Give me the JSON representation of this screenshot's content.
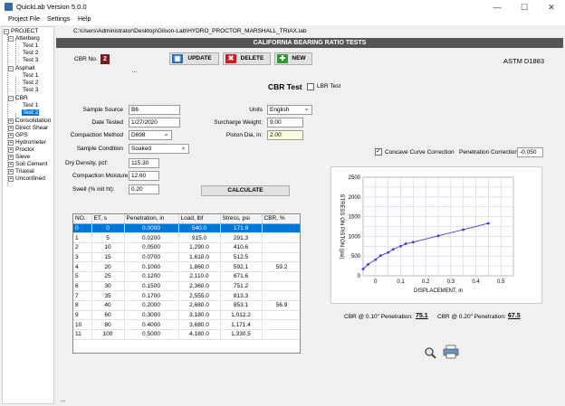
{
  "window": {
    "title": "QuickLab  Version 5.0.0",
    "minimize": "—",
    "maximize": "☐",
    "close": "✕"
  },
  "menu": [
    "Project File",
    "Settings",
    "Help"
  ],
  "tree": {
    "root": "PROJECT",
    "groups": [
      {
        "name": "Atterberg",
        "expanded": true,
        "children": [
          "Test 1",
          "Test 2",
          "Test 3"
        ]
      },
      {
        "name": "Asphalt",
        "expanded": true,
        "children": [
          "Test 1",
          "Test 2",
          "Test 3"
        ]
      },
      {
        "name": "CBR",
        "expanded": true,
        "children": [
          "Test 1",
          "Test 2"
        ]
      },
      {
        "name": "Consolidation"
      },
      {
        "name": "Direct Shear"
      },
      {
        "name": "GPS"
      },
      {
        "name": "Hydrometer"
      },
      {
        "name": "Proctor"
      },
      {
        "name": "Sieve"
      },
      {
        "name": "Soil Cement"
      },
      {
        "name": "Triaxial"
      },
      {
        "name": "Unconfined"
      }
    ],
    "selected": "Test 2"
  },
  "file_path": "C:\\Users\\Administrator\\Desktop\\Gilson-Lab\\HYDRO_PROCTOR_MARSHALL_TRIAX.lab",
  "header_title": "CALIFORNIA BEARING RATIO TESTS",
  "cbr_no": {
    "label": "CBR No.",
    "value": "2"
  },
  "toolbar": {
    "update": "UPDATE",
    "delete": "DELETE",
    "new": "NEW"
  },
  "standard": "ASTM D1883",
  "ellipsis": "...",
  "bottom_ellipsis": "...",
  "cbr_test_title": "CBR Test",
  "lbr_test_label": "LBR Test",
  "lbr_checked": false,
  "form": {
    "sample_source_label": "Sample Source",
    "sample_source": "B6",
    "date_tested_label": "Date Tested",
    "date_tested": "1/27/2020",
    "compaction_method_label": "Compaction Method",
    "compaction_method": "D698",
    "sample_condition_label": "Sample Condition",
    "sample_condition": "Soaked",
    "dry_density_label": "Dry Density, pcf:",
    "dry_density": "115.30",
    "compaction_moisture_label": "Compaction Moisture",
    "compaction_moisture": "12.60",
    "swell_label": "Swell (% init ht):",
    "swell": "0.20",
    "units_label": "Units",
    "units": "English",
    "surcharge_label": "Surcharge Weight:",
    "surcharge": "9.00",
    "piston_label": "Piston Dia, in:",
    "piston": "2.00",
    "calculate": "CALCULATE"
  },
  "correction": {
    "concave_label": "Concave Curve Correction",
    "concave_checked": true,
    "penetration_label": "Penetration Correction:",
    "penetration_value": "-0.050"
  },
  "table": {
    "headers": [
      "NO.",
      "ET, s",
      "Penetration, in",
      "Load, lbf",
      "Stress, psi",
      "CBR, %"
    ],
    "rows": [
      [
        "0",
        "0",
        "0.0000",
        "540.0",
        "171.9",
        ""
      ],
      [
        "1",
        "5",
        "0.0200",
        "915.0",
        "291.3",
        ""
      ],
      [
        "2",
        "10",
        "0.0500",
        "1,290.0",
        "410.6",
        ""
      ],
      [
        "3",
        "15",
        "0.0700",
        "1,610.0",
        "512.5",
        ""
      ],
      [
        "4",
        "20",
        "0.1000",
        "1,860.0",
        "592.1",
        "59.2"
      ],
      [
        "5",
        "25",
        "0.1200",
        "2,110.0",
        "671.6",
        ""
      ],
      [
        "6",
        "30",
        "0.1500",
        "2,360.0",
        "751.2",
        ""
      ],
      [
        "7",
        "35",
        "0.1700",
        "2,555.0",
        "813.3",
        ""
      ],
      [
        "8",
        "40",
        "0.2000",
        "2,680.0",
        "853.1",
        "56.9"
      ],
      [
        "9",
        "60",
        "0.3000",
        "3,180.0",
        "1,012.2",
        ""
      ],
      [
        "10",
        "80",
        "0.4000",
        "3,680.0",
        "1,171.4",
        ""
      ],
      [
        "11",
        "100",
        "0.5000",
        "4,180.0",
        "1,330.5",
        ""
      ]
    ],
    "selected_row": 0
  },
  "chart_data": {
    "type": "line",
    "xlabel": "DISPLACEMENT, in",
    "ylabel": "STRESS ON PISTON (psi)",
    "xlim": [
      -0.05,
      0.55
    ],
    "ylim": [
      0,
      2500
    ],
    "xticks": [
      "0",
      "0.1",
      "0.2",
      "0.3",
      "0.4",
      "0.5"
    ],
    "yticks": [
      "0",
      "500",
      "1000",
      "1500",
      "2000",
      "2500"
    ],
    "grid": true,
    "series": [
      {
        "x": [
          -0.05,
          -0.03,
          0.0,
          0.02,
          0.05,
          0.07,
          0.1,
          0.12,
          0.15,
          0.25,
          0.35,
          0.45
        ],
        "y": [
          171.9,
          291.3,
          410.6,
          512.5,
          592.1,
          671.6,
          751.2,
          813.3,
          853.1,
          1012.2,
          1171.4,
          1330.5
        ],
        "color": "#3b3bd6"
      }
    ]
  },
  "results": {
    "cbr_010_label": "CBR @ 0.10\" Penetration:",
    "cbr_010": "75.1",
    "cbr_020_label": "CBR @ 0.20\" Penetration:",
    "cbr_020": "67.5"
  },
  "icons": {
    "zoom": "magnifier-icon",
    "print": "printer-icon"
  }
}
